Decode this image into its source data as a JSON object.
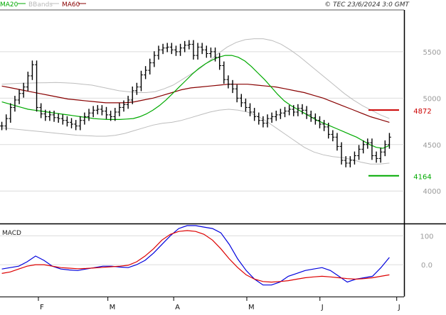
{
  "legend": {
    "ma20": "MA20",
    "bbands": "BBands",
    "ma60": "MA60"
  },
  "header": {
    "copyright": "© TEC 23/6/2024 3:0 GMT"
  },
  "macd_label": "MACD",
  "colors": {
    "price": "#000000",
    "ma20": "#00aa00",
    "ma60": "#880000",
    "bbands": "#bdbdbd",
    "macd": "#0000dd",
    "signal": "#dd0000",
    "resistance": "#cc0000",
    "support": "#00aa00",
    "grid": "#dcdcdc"
  },
  "chart_data": [
    {
      "type": "line",
      "panel": "price",
      "ylim": [
        3650,
        5950
      ],
      "yticks": [
        {
          "value": 4000,
          "label": "4000"
        },
        {
          "value": 4500,
          "label": "4500"
        },
        {
          "value": 5000,
          "label": "5000"
        },
        {
          "value": 5500,
          "label": "5500"
        }
      ],
      "xticks": [
        "F",
        "M",
        "A",
        "M",
        "J",
        "J"
      ],
      "xtick_index": [
        10,
        29,
        47,
        67,
        87,
        108
      ],
      "x_range": [
        -0.5,
        110
      ],
      "levels": [
        {
          "name": "resistance",
          "value": 4872,
          "label": "4872"
        },
        {
          "name": "support",
          "value": 4164,
          "label": "4164"
        }
      ],
      "series": [
        {
          "name": "price",
          "style": "ohlc",
          "values": [
            4700,
            4780,
            4900,
            4980,
            5050,
            5120,
            5240,
            5360,
            4900,
            4830,
            4800,
            4820,
            4790,
            4780,
            4760,
            4740,
            4720,
            4700,
            4760,
            4800,
            4840,
            4870,
            4880,
            4860,
            4820,
            4800,
            4850,
            4900,
            4930,
            4980,
            5080,
            5120,
            5250,
            5300,
            5380,
            5460,
            5520,
            5540,
            5550,
            5520,
            5500,
            5540,
            5570,
            5580,
            5460,
            5550,
            5520,
            5480,
            5500,
            5440,
            5350,
            5200,
            5150,
            5100,
            5000,
            4950,
            4900,
            4850,
            4800,
            4760,
            4730,
            4780,
            4800,
            4820,
            4840,
            4860,
            4880,
            4850,
            4890,
            4870,
            4820,
            4790,
            4760,
            4720,
            4690,
            4610,
            4580,
            4480,
            4330,
            4300,
            4330,
            4380,
            4450,
            4500,
            4520,
            4380,
            4350,
            4420,
            4500,
            4580
          ]
        },
        {
          "name": "MA20",
          "style": "line",
          "values": [
            4960,
            4940,
            4920,
            4900,
            4880,
            4870,
            4860,
            4850,
            4840,
            4830,
            4820,
            4810,
            4800,
            4790,
            4780,
            4775,
            4770,
            4770,
            4770,
            4775,
            4780,
            4800,
            4830,
            4870,
            4920,
            4980,
            5050,
            5120,
            5190,
            5260,
            5320,
            5370,
            5410,
            5440,
            5460,
            5460,
            5440,
            5400,
            5340,
            5270,
            5200,
            5120,
            5040,
            4970,
            4920,
            4880,
            4840,
            4800,
            4760,
            4730,
            4700,
            4670,
            4640,
            4610,
            4580,
            4540,
            4500,
            4470,
            4460,
            4490
          ]
        },
        {
          "name": "MA60",
          "style": "line",
          "values": [
            5130,
            5110,
            5090,
            5070,
            5050,
            5030,
            5010,
            4990,
            4980,
            4970,
            4960,
            4950,
            4950,
            4950,
            4960,
            4980,
            5000,
            5030,
            5060,
            5090,
            5110,
            5120,
            5130,
            5140,
            5150,
            5150,
            5150,
            5140,
            5130,
            5120,
            5100,
            5080,
            5060,
            5030,
            5000,
            4960,
            4920,
            4880,
            4840,
            4800,
            4770,
            4740
          ]
        },
        {
          "name": "BBandUpper",
          "style": "line",
          "values": [
            5150,
            5155,
            5160,
            5162,
            5165,
            5166,
            5168,
            5165,
            5160,
            5150,
            5140,
            5120,
            5100,
            5080,
            5070,
            5060,
            5060,
            5070,
            5100,
            5140,
            5200,
            5260,
            5320,
            5400,
            5480,
            5550,
            5600,
            5630,
            5640,
            5640,
            5620,
            5580,
            5520,
            5450,
            5370,
            5290,
            5210,
            5130,
            5050,
            4980,
            4920,
            4870,
            4820,
            4780
          ]
        },
        {
          "name": "BBandLower",
          "style": "line",
          "values": [
            4680,
            4670,
            4660,
            4650,
            4640,
            4630,
            4620,
            4610,
            4600,
            4595,
            4590,
            4590,
            4600,
            4620,
            4650,
            4680,
            4710,
            4730,
            4740,
            4760,
            4790,
            4820,
            4850,
            4870,
            4880,
            4870,
            4850,
            4810,
            4750,
            4680,
            4610,
            4540,
            4470,
            4420,
            4390,
            4370,
            4360,
            4340,
            4310,
            4290,
            4290,
            4300
          ]
        }
      ]
    },
    {
      "type": "line",
      "panel": "macd",
      "ylim": [
        -110,
        140
      ],
      "yticks": [
        {
          "value": 0,
          "label": "0.0"
        },
        {
          "value": 100,
          "label": "100"
        }
      ],
      "zero_line": 0,
      "series": [
        {
          "name": "MACD",
          "values": [
            -15,
            -10,
            -5,
            10,
            30,
            15,
            -5,
            -15,
            -18,
            -20,
            -15,
            -10,
            -5,
            -5,
            -8,
            -10,
            0,
            15,
            40,
            70,
            100,
            125,
            135,
            135,
            130,
            125,
            110,
            70,
            20,
            -20,
            -50,
            -70,
            -70,
            -60,
            -40,
            -30,
            -20,
            -15,
            -10,
            -20,
            -40,
            -60,
            -50,
            -45,
            -40,
            -10,
            25
          ]
        },
        {
          "name": "Signal",
          "values": [
            -30,
            -25,
            -15,
            -5,
            0,
            0,
            -5,
            -10,
            -12,
            -14,
            -13,
            -11,
            -9,
            -7,
            -5,
            -2,
            10,
            30,
            55,
            85,
            105,
            115,
            118,
            115,
            105,
            85,
            55,
            20,
            -10,
            -35,
            -50,
            -58,
            -60,
            -58,
            -55,
            -50,
            -45,
            -42,
            -40,
            -42,
            -45,
            -48,
            -50,
            -48,
            -45,
            -40,
            -35
          ]
        }
      ]
    }
  ]
}
